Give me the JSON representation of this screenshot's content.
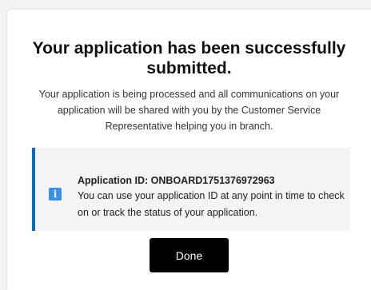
{
  "dialog": {
    "heading": "Your application has been successfully submitted.",
    "message": "Your application is being processed and all communications on your application will be shared with you by the Customer Service Representative helping you in branch.",
    "notice": {
      "icon": "info-icon",
      "icon_glyph": "i",
      "application_id_label": "Application ID: ONBOARD1751376972963",
      "description": "You can use your application ID at any point in time to check on or track the status of your application."
    },
    "done_label": "Done"
  },
  "colors": {
    "accent": "#0f6cbd",
    "info_icon": "#3a8ee6",
    "button_bg": "#000000",
    "notice_bg": "#f4f4f4"
  }
}
